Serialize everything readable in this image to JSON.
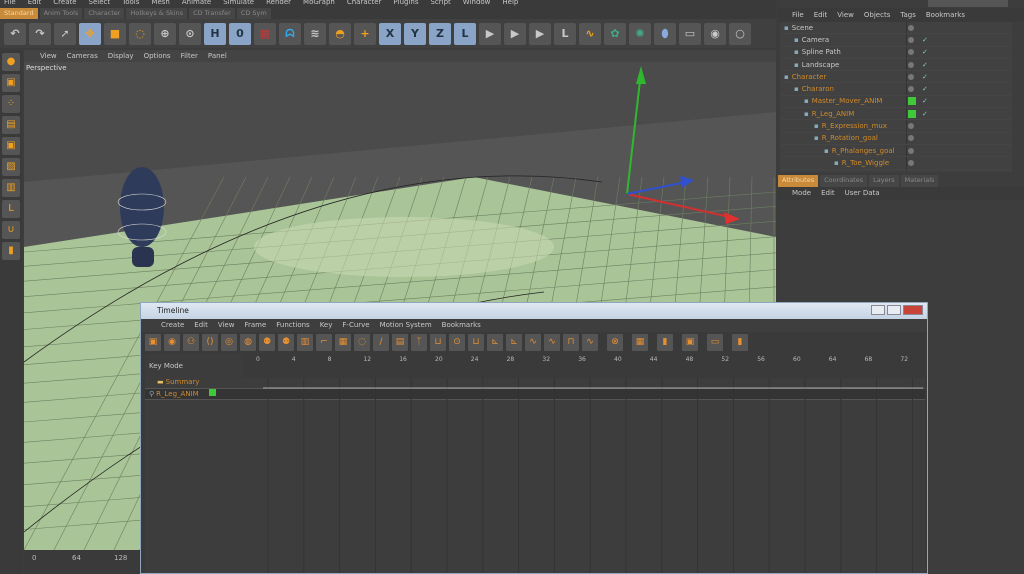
{
  "menu": [
    "File",
    "Edit",
    "Create",
    "Select",
    "Tools",
    "Mesh",
    "Animate",
    "Simulate",
    "Render",
    "MoGraph",
    "Character",
    "Plugins",
    "Script",
    "Window",
    "Help"
  ],
  "palette_tabs": [
    {
      "label": "Standard",
      "active": true
    },
    {
      "label": "Anim Tools"
    },
    {
      "label": "Character"
    },
    {
      "label": "Hotkeys & Skins"
    },
    {
      "label": "CD Transfer"
    },
    {
      "label": "CD Sym"
    }
  ],
  "viewport": {
    "menu": [
      "View",
      "Cameras",
      "Display",
      "Options",
      "Filter",
      "Panel"
    ],
    "label": "Perspective",
    "ruler_ticks": [
      "0",
      "64",
      "128"
    ]
  },
  "object_manager": {
    "menu": [
      "File",
      "Edit",
      "View",
      "Objects",
      "Tags",
      "Bookmarks"
    ],
    "objects": [
      {
        "name": "Scene",
        "indent": 0,
        "color": "normal"
      },
      {
        "name": "Camera",
        "indent": 1,
        "color": "normal"
      },
      {
        "name": "Spline Path",
        "indent": 1,
        "color": "normal"
      },
      {
        "name": "Landscape",
        "indent": 1,
        "color": "normal"
      },
      {
        "name": "Character",
        "indent": 0,
        "color": "orange"
      },
      {
        "name": "Chararon",
        "indent": 1,
        "color": "orange"
      },
      {
        "name": "Master_Mover_ANIM",
        "indent": 2,
        "color": "orange",
        "green": true
      },
      {
        "name": "R_Leg_ANIM",
        "indent": 2,
        "color": "orange",
        "green": true
      },
      {
        "name": "R_Expression_mux",
        "indent": 3,
        "color": "orange"
      },
      {
        "name": "R_Rotation_goal",
        "indent": 3,
        "color": "orange"
      },
      {
        "name": "R_Phalanges_goal",
        "indent": 4,
        "color": "orange"
      },
      {
        "name": "R_Toe_Wiggle",
        "indent": 5,
        "color": "orange"
      }
    ]
  },
  "attributes": {
    "tabs": [
      "Attributes",
      "Coordinates",
      "Layers",
      "Materials"
    ],
    "menu": [
      "Mode",
      "Edit",
      "User Data"
    ]
  },
  "timeline": {
    "title": "Timeline",
    "menu": [
      "Create",
      "Edit",
      "View",
      "Frame",
      "Functions",
      "Key",
      "F-Curve",
      "Motion System",
      "Bookmarks"
    ],
    "key_mode": "Key Mode",
    "ticks": [
      "0",
      "4",
      "8",
      "12",
      "16",
      "20",
      "24",
      "28",
      "32",
      "36",
      "40",
      "44",
      "48",
      "52",
      "56",
      "60",
      "64",
      "68",
      "72"
    ],
    "rows": [
      {
        "name": "Summary"
      },
      {
        "name": "R_Leg_ANIM"
      }
    ]
  },
  "colors": {
    "accent": "#c98a3a",
    "ground": "#a9c496",
    "selected_tag": "#3ec83a"
  }
}
